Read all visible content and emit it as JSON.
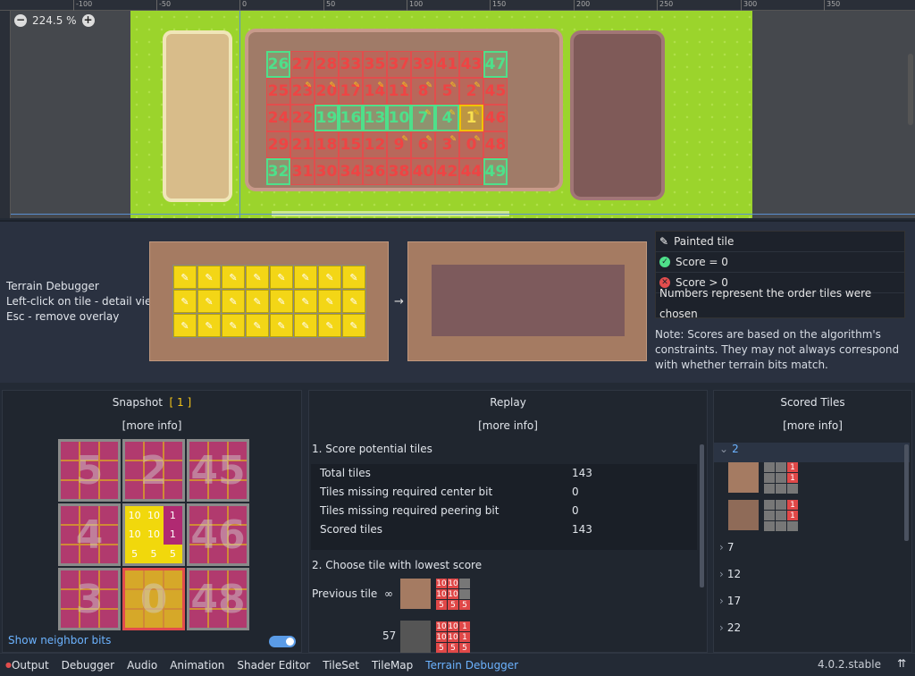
{
  "viewport": {
    "zoom_label": "224.5 %",
    "zoom_out_icon": "minus",
    "zoom_in_icon": "plus",
    "ruler_marks": [
      "-100",
      "-50",
      "0",
      "50",
      "100",
      "150",
      "200",
      "250",
      "300",
      "350"
    ],
    "tile_rows": [
      [
        {
          "n": "26",
          "s": "green"
        },
        {
          "n": "27",
          "s": "red"
        },
        {
          "n": "28",
          "s": "red"
        },
        {
          "n": "33",
          "s": "red"
        },
        {
          "n": "35",
          "s": "red"
        },
        {
          "n": "37",
          "s": "red"
        },
        {
          "n": "39",
          "s": "red"
        },
        {
          "n": "41",
          "s": "red"
        },
        {
          "n": "43",
          "s": "red"
        },
        {
          "n": "47",
          "s": "green"
        }
      ],
      [
        {
          "n": "25",
          "s": "red"
        },
        {
          "n": "23",
          "s": "red",
          "p": true
        },
        {
          "n": "20",
          "s": "red",
          "p": true
        },
        {
          "n": "17",
          "s": "red",
          "p": true
        },
        {
          "n": "14",
          "s": "red",
          "p": true
        },
        {
          "n": "11",
          "s": "red",
          "p": true
        },
        {
          "n": "8",
          "s": "red",
          "p": true
        },
        {
          "n": "5",
          "s": "red",
          "p": true
        },
        {
          "n": "2",
          "s": "red",
          "p": true
        },
        {
          "n": "45",
          "s": "red"
        }
      ],
      [
        {
          "n": "24",
          "s": "red"
        },
        {
          "n": "22",
          "s": "red"
        },
        {
          "n": "19",
          "s": "green"
        },
        {
          "n": "16",
          "s": "green"
        },
        {
          "n": "13",
          "s": "green"
        },
        {
          "n": "10",
          "s": "green"
        },
        {
          "n": "7",
          "s": "green",
          "p": true
        },
        {
          "n": "4",
          "s": "green",
          "p": true
        },
        {
          "n": "1",
          "s": "gold",
          "p": true
        },
        {
          "n": "46",
          "s": "red"
        }
      ],
      [
        {
          "n": "29",
          "s": "red"
        },
        {
          "n": "21",
          "s": "red"
        },
        {
          "n": "18",
          "s": "red"
        },
        {
          "n": "15",
          "s": "red"
        },
        {
          "n": "12",
          "s": "red"
        },
        {
          "n": "9",
          "s": "red",
          "p": true
        },
        {
          "n": "6",
          "s": "red",
          "p": true
        },
        {
          "n": "3",
          "s": "red",
          "p": true
        },
        {
          "n": "0",
          "s": "red",
          "p": true
        },
        {
          "n": "48",
          "s": "red"
        }
      ],
      [
        {
          "n": "32",
          "s": "green"
        },
        {
          "n": "31",
          "s": "red"
        },
        {
          "n": "30",
          "s": "red"
        },
        {
          "n": "34",
          "s": "red"
        },
        {
          "n": "36",
          "s": "red"
        },
        {
          "n": "38",
          "s": "red"
        },
        {
          "n": "40",
          "s": "red"
        },
        {
          "n": "42",
          "s": "red"
        },
        {
          "n": "44",
          "s": "red"
        },
        {
          "n": "49",
          "s": "green"
        }
      ]
    ]
  },
  "debugger_info": {
    "title": "Terrain Debugger",
    "line1": "Left-click on tile - detail view",
    "line2": "Esc - remove overlay",
    "arrow": "→"
  },
  "legend": {
    "painted": "Painted tile",
    "score_zero": "Score = 0",
    "score_pos": "Score > 0",
    "numbers": "Numbers represent the order tiles were chosen",
    "note": "Note: Scores are based on the algorithm's constraints. They may not always correspond with whether terrain bits match."
  },
  "snapshot": {
    "title": "Snapshot",
    "index": "[ 1 ]",
    "more_info": "[more info]",
    "cells": [
      "5",
      "2",
      "45",
      "4",
      "",
      "46",
      "3",
      "0",
      "48"
    ],
    "center_bits": [
      "10",
      "10",
      "1",
      "10",
      "10",
      "1",
      "5",
      "5",
      "5"
    ],
    "show_bits_label": "Show neighbor bits"
  },
  "replay": {
    "title": "Replay",
    "more_info": "[more info]",
    "step1": "1. Score potential tiles",
    "stats": [
      {
        "k": "Total tiles",
        "v": "143"
      },
      {
        "k": "Tiles missing required center bit",
        "v": "0"
      },
      {
        "k": "Tiles missing required peering bit",
        "v": "0"
      },
      {
        "k": "Scored tiles",
        "v": "143"
      }
    ],
    "step2": "2. Choose tile with lowest score",
    "prev_label": "Previous tile",
    "prev_inf": "∞",
    "prev_bits": [
      "10",
      "10",
      "",
      "10",
      "10",
      "",
      "5",
      "5",
      "5"
    ],
    "next_num": "57",
    "next_bits": [
      "10",
      "10",
      "1",
      "10",
      "10",
      "1",
      "5",
      "5",
      "5"
    ]
  },
  "scored": {
    "title": "Scored Tiles",
    "more_info": "[more info]",
    "groups": [
      "2",
      "7",
      "12",
      "17",
      "22"
    ],
    "tile_a_bits": [
      "",
      "",
      "1",
      "",
      "",
      "1",
      "",
      "",
      ""
    ],
    "tile_b_bits": [
      "",
      "",
      "1",
      "",
      "",
      "1",
      "",
      "",
      ""
    ]
  },
  "tabs": [
    "Output",
    "Debugger",
    "Audio",
    "Animation",
    "Shader Editor",
    "TileSet",
    "TileMap",
    "Terrain Debugger"
  ],
  "version": "4.0.2.stable"
}
